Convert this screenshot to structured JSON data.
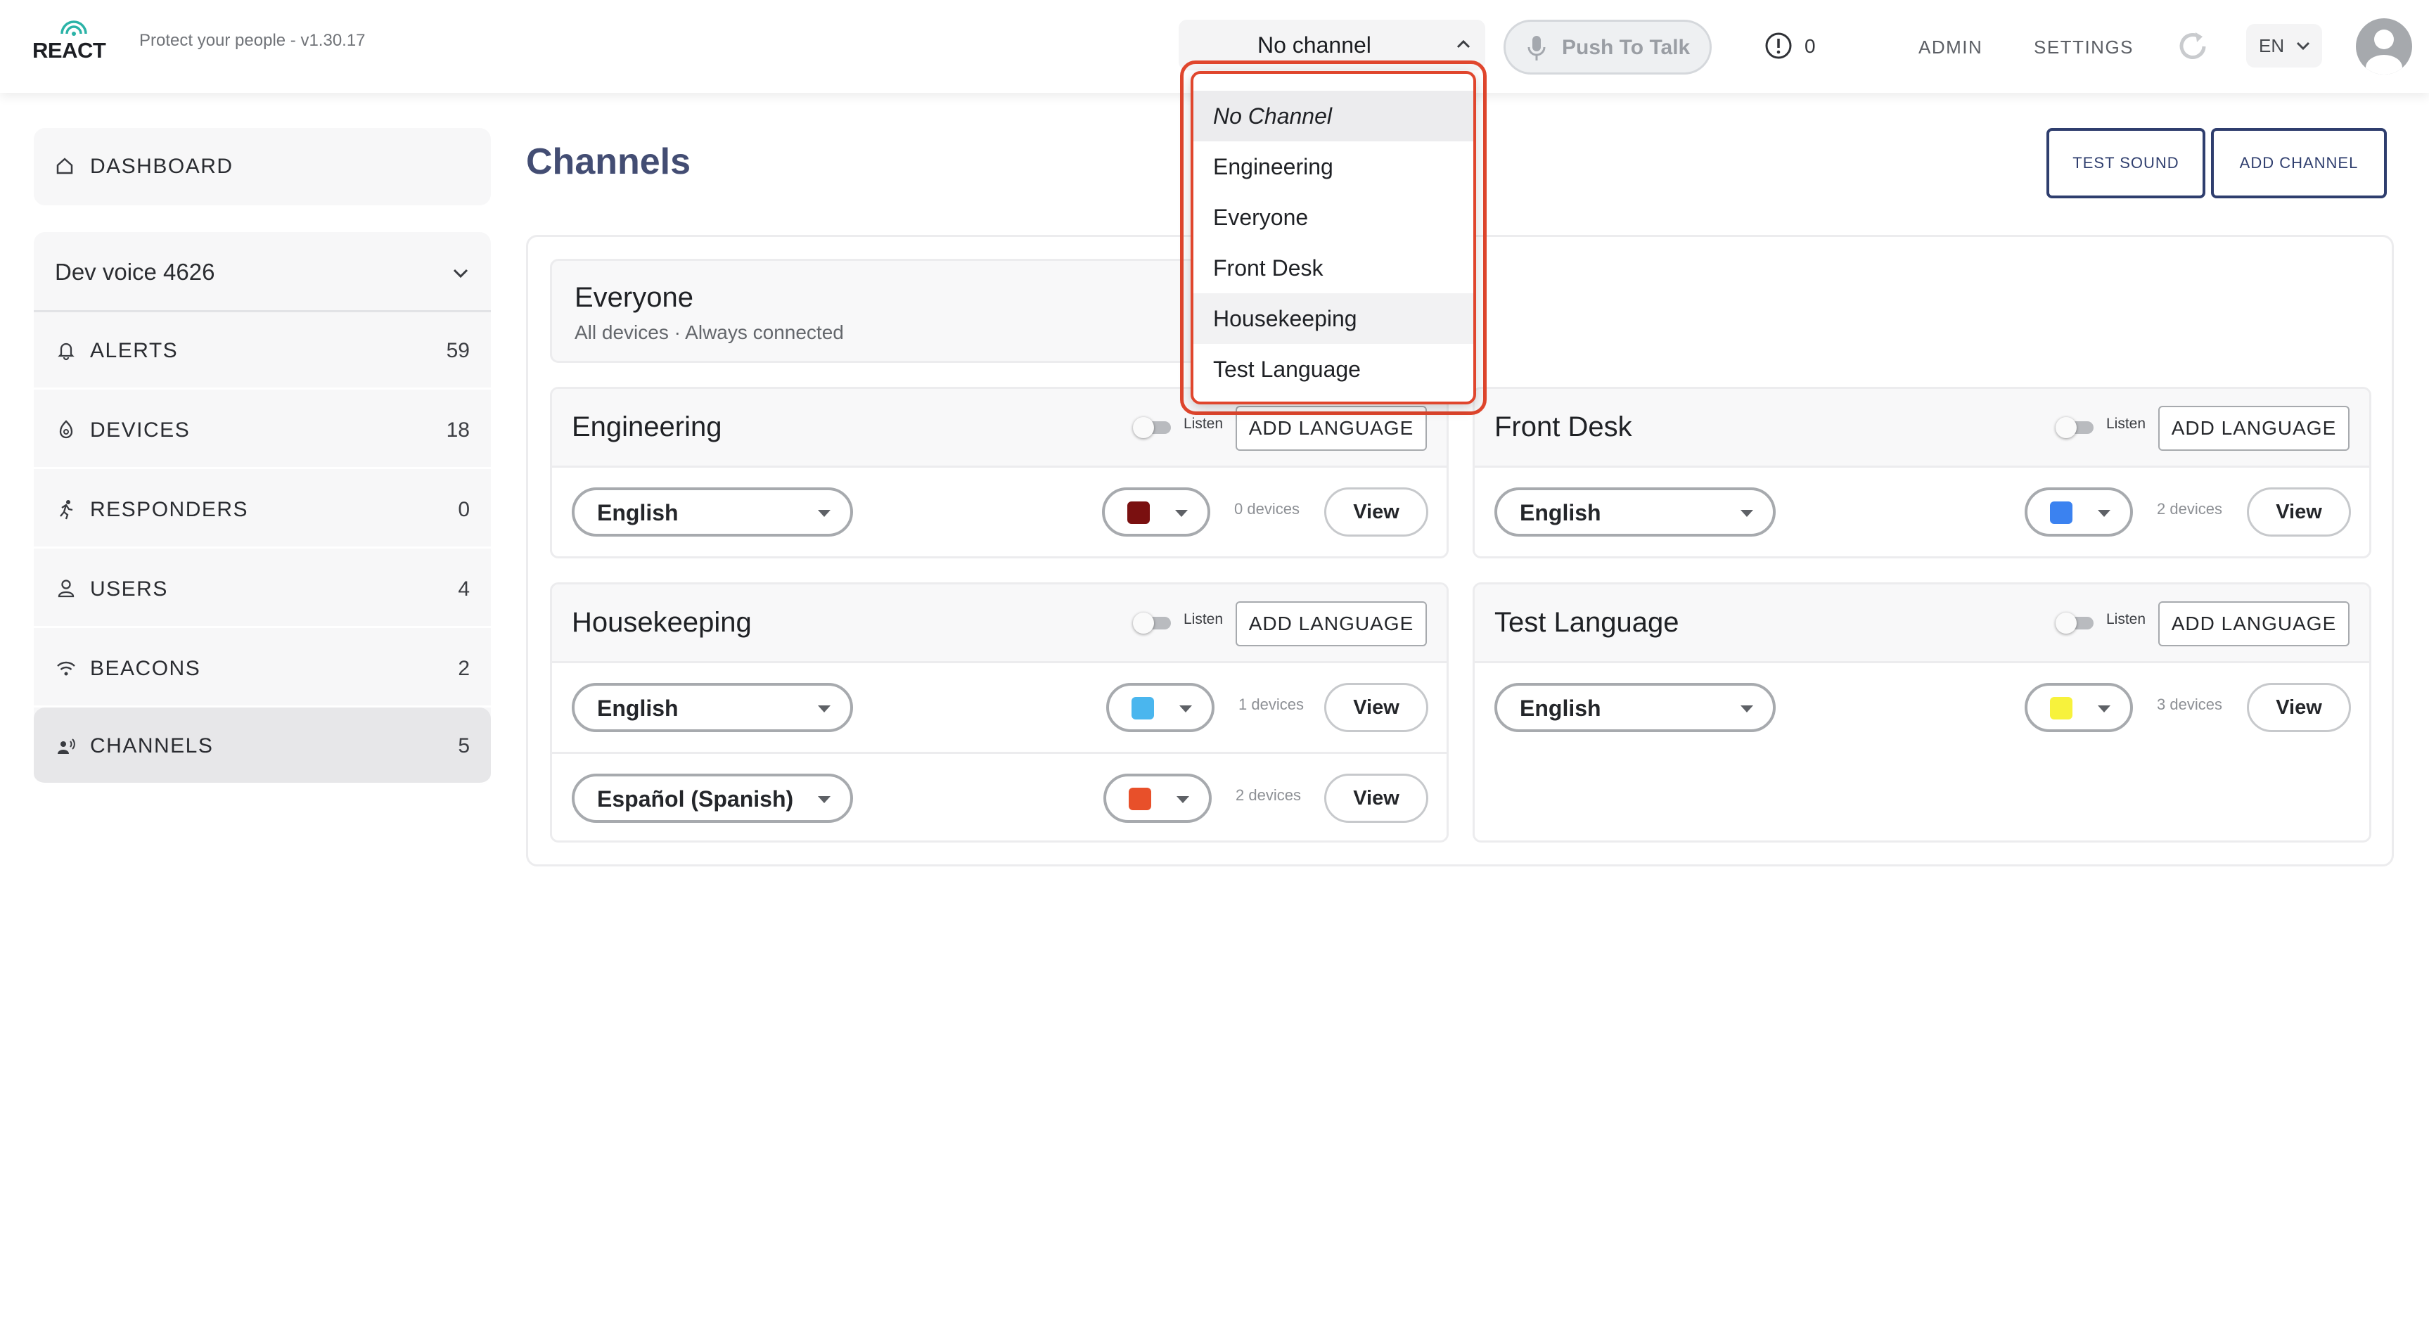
{
  "app": {
    "logo_text": "REACT",
    "tagline": "Protect your people - v1.30.17"
  },
  "topbar": {
    "channel_select_value": "No channel",
    "push_to_talk_label": "Push To Talk",
    "alert_count": "0",
    "admin_label": "ADMIN",
    "settings_label": "SETTINGS",
    "language_code": "EN"
  },
  "sidebar": {
    "dashboard_label": "DASHBOARD",
    "org_name": "Dev voice 4626",
    "items": [
      {
        "label": "ALERTS",
        "count": "59",
        "icon": "bell-icon"
      },
      {
        "label": "DEVICES",
        "count": "18",
        "icon": "device-icon"
      },
      {
        "label": "RESPONDERS",
        "count": "0",
        "icon": "running-person-icon"
      },
      {
        "label": "USERS",
        "count": "4",
        "icon": "user-icon"
      },
      {
        "label": "BEACONS",
        "count": "2",
        "icon": "wifi-icon"
      },
      {
        "label": "CHANNELS",
        "count": "5",
        "icon": "speaking-person-icon",
        "active": true
      }
    ]
  },
  "main": {
    "title": "Channels",
    "test_sound_label": "TEST SOUND",
    "add_channel_label": "ADD CHANNEL",
    "everyone": {
      "title": "Everyone",
      "subtitle": "All devices · Always connected"
    },
    "listen_label": "Listen",
    "add_language_label": "ADD LANGUAGE",
    "view_label": "View",
    "cards": [
      {
        "title": "Engineering",
        "rows": [
          {
            "language": "English",
            "color": "#7a1010",
            "devices": "0 devices"
          }
        ]
      },
      {
        "title": "Front Desk",
        "rows": [
          {
            "language": "English",
            "color": "#3b82f0",
            "devices": "2 devices"
          }
        ]
      },
      {
        "title": "Housekeeping",
        "rows": [
          {
            "language": "English",
            "color": "#4ab6ee",
            "devices": "1 devices"
          },
          {
            "language": "Español (Spanish)",
            "color": "#e8502a",
            "devices": "2 devices"
          }
        ]
      },
      {
        "title": "Test Language",
        "rows": [
          {
            "language": "English",
            "color": "#f7f23c",
            "devices": "3 devices"
          }
        ]
      }
    ]
  },
  "channel_dropdown": {
    "options": [
      "No Channel",
      "Engineering",
      "Everyone",
      "Front Desk",
      "Housekeeping",
      "Test Language"
    ],
    "selected_index": 0,
    "hover_index": 4
  },
  "colors": {
    "accent": "#2f3e6e",
    "highlight_border": "#e0462d"
  }
}
